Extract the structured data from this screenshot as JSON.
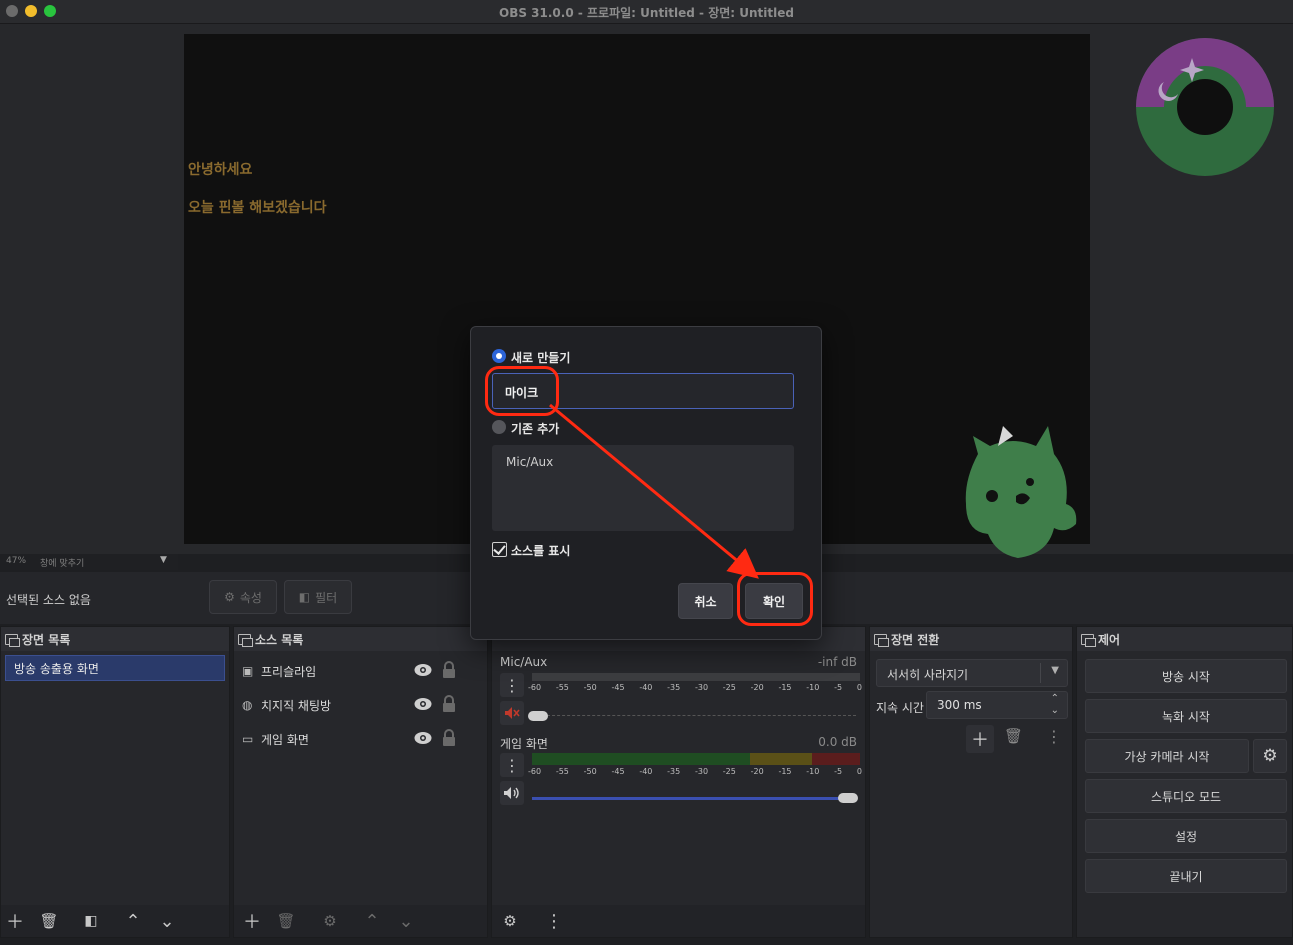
{
  "window": {
    "title": "OBS 31.0.0 - 프로파일: Untitled - 장면: Untitled"
  },
  "preview": {
    "lines": [
      "안녕하세요",
      "오늘 핀볼 해보겠습니다"
    ],
    "zoom": "47%",
    "fit_label": "창에 맞추기"
  },
  "context": {
    "selected": "선택된 소스 없음",
    "properties": "속성",
    "filters": "필터"
  },
  "scenes": {
    "header": "장면 목록",
    "items": [
      "방송 송출용 화면"
    ]
  },
  "sources": {
    "header": "소스 목록",
    "items": [
      "프리슬라임",
      "치지직 채팅방",
      "게임 화면"
    ]
  },
  "mixer": {
    "channels": [
      {
        "name": "Mic/Aux",
        "db": "-inf dB",
        "muted": true,
        "volume": 0.0
      },
      {
        "name": "게임 화면",
        "db": "0.0 dB",
        "muted": false,
        "volume": 1.0
      }
    ],
    "scale": [
      "-60",
      "-55",
      "-50",
      "-45",
      "-40",
      "-35",
      "-30",
      "-25",
      "-20",
      "-15",
      "-10",
      "-5",
      "0"
    ]
  },
  "transitions": {
    "header": "장면 전환",
    "selected": "서서히 사라지기",
    "duration_label": "지속 시간",
    "duration": "300 ms"
  },
  "controls": {
    "header": "제어",
    "stream": "방송 시작",
    "record": "녹화 시작",
    "virtual_cam": "가상 카메라 시작",
    "studio": "스튜디오 모드",
    "settings": "설정",
    "exit": "끝내기"
  },
  "dialog": {
    "create_new": "새로 만들기",
    "name_value": "마이크",
    "add_existing": "기존 추가",
    "existing_items": [
      "Mic/Aux"
    ],
    "show_source": "소스를 표시",
    "show_source_checked": true,
    "cancel": "취소",
    "ok": "확인"
  },
  "colors": {
    "accent": "#2c64d8",
    "annotation": "#ff2a12",
    "overlay_text": "#8a6a2e"
  }
}
